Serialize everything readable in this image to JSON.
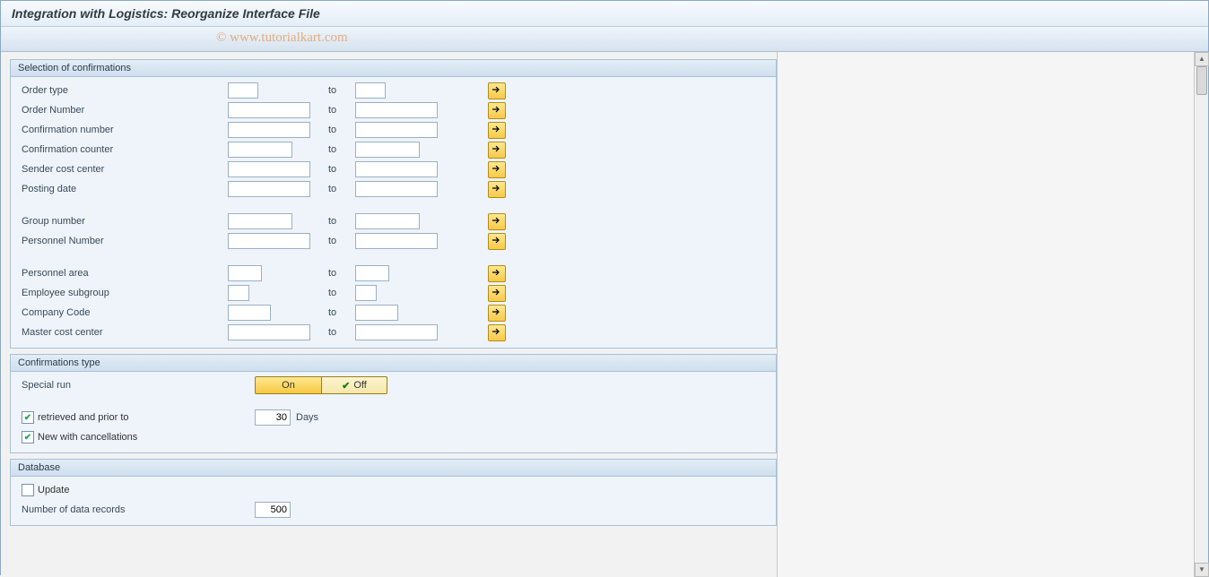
{
  "title": "Integration with Logistics: Reorganize Interface File",
  "watermark": "© www.tutorialkart.com",
  "selection": {
    "header": "Selection of confirmations",
    "to_label": "to",
    "rows1": [
      {
        "label": "Order type",
        "fw": 34,
        "tw": 34,
        "from": "",
        "to": ""
      },
      {
        "label": "Order Number",
        "fw": 92,
        "tw": 92,
        "from": "",
        "to": ""
      },
      {
        "label": "Confirmation number",
        "fw": 92,
        "tw": 92,
        "from": "",
        "to": ""
      },
      {
        "label": "Confirmation counter",
        "fw": 72,
        "tw": 72,
        "from": "",
        "to": ""
      },
      {
        "label": "Sender cost center",
        "fw": 92,
        "tw": 92,
        "from": "",
        "to": ""
      },
      {
        "label": "Posting date",
        "fw": 92,
        "tw": 92,
        "from": "",
        "to": ""
      }
    ],
    "rows2": [
      {
        "label": "Group number",
        "fw": 72,
        "tw": 72,
        "from": "",
        "to": ""
      },
      {
        "label": "Personnel Number",
        "fw": 92,
        "tw": 92,
        "from": "",
        "to": ""
      }
    ],
    "rows3": [
      {
        "label": "Personnel area",
        "fw": 38,
        "tw": 38,
        "from": "",
        "to": ""
      },
      {
        "label": "Employee subgroup",
        "fw": 24,
        "tw": 24,
        "from": "",
        "to": ""
      },
      {
        "label": "Company Code",
        "fw": 48,
        "tw": 48,
        "from": "",
        "to": ""
      },
      {
        "label": "Master cost center",
        "fw": 92,
        "tw": 92,
        "from": "",
        "to": ""
      }
    ]
  },
  "conf_type": {
    "header": "Confirmations type",
    "special_run": "Special run",
    "on": "On",
    "off": "Off",
    "retrieved": {
      "checked": true,
      "label": "retrieved and prior to",
      "value": "30",
      "unit": "Days"
    },
    "new_cancel": {
      "checked": true,
      "label": "New with cancellations"
    }
  },
  "database": {
    "header": "Database",
    "update": {
      "checked": false,
      "label": "Update"
    },
    "num_records": {
      "label": "Number of data records",
      "value": "500"
    }
  }
}
